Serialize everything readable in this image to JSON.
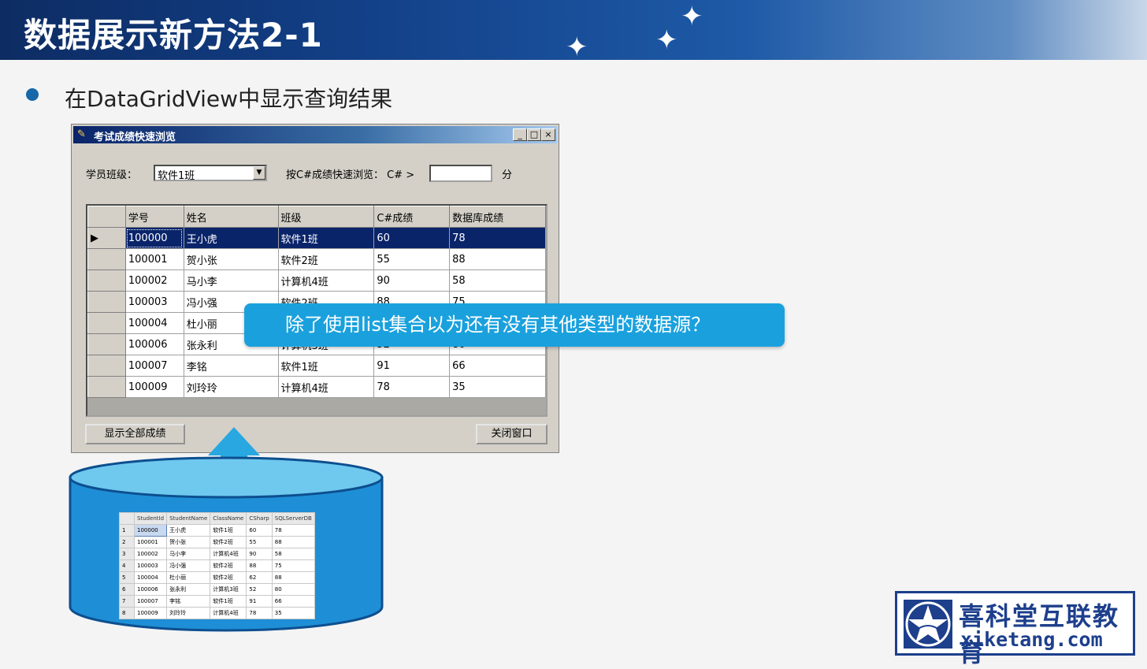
{
  "slide": {
    "title": "数据展示新方法2-1",
    "bullet": "在DataGridView中显示查询结果"
  },
  "form": {
    "title": "考试成绩快速浏览",
    "title_buttons": [
      "_",
      "□",
      "×"
    ],
    "class_label": "学员班级：",
    "class_value": "软件1班",
    "csharp_label": "按C#成绩快速浏览： C# >",
    "textbox_value": "",
    "unit_label": "分",
    "grid_columns": [
      "学号",
      "姓名",
      "班级",
      "C#成绩",
      "数据库成绩"
    ],
    "grid_rows": [
      [
        "100000",
        "王小虎",
        "软件1班",
        "60",
        "78"
      ],
      [
        "100001",
        "贺小张",
        "软件2班",
        "55",
        "88"
      ],
      [
        "100002",
        "马小李",
        "计算机4班",
        "90",
        "58"
      ],
      [
        "100003",
        "冯小强",
        "软件2班",
        "88",
        "75"
      ],
      [
        "100004",
        "杜小丽",
        "",
        "",
        ""
      ],
      [
        "100006",
        "张永利",
        "计算机3班",
        "52",
        "80"
      ],
      [
        "100007",
        "李铭",
        "软件1班",
        "91",
        "66"
      ],
      [
        "100009",
        "刘玲玲",
        "计算机4班",
        "78",
        "35"
      ]
    ],
    "selected_row_marker": "▶",
    "show_all_button": "显示全部成绩",
    "close_button": "关闭窗口"
  },
  "callout": {
    "text": "除了使用list集合以为还有没有其他类型的数据源？"
  },
  "database_table": {
    "columns": [
      "",
      "StudentId",
      "StudentName",
      "ClassName",
      "CSharp",
      "SQLServerDB"
    ],
    "rows": [
      [
        "1",
        "100000",
        "王小虎",
        "软件1班",
        "60",
        "78"
      ],
      [
        "2",
        "100001",
        "贺小张",
        "软件2班",
        "55",
        "88"
      ],
      [
        "3",
        "100002",
        "马小李",
        "计算机4班",
        "90",
        "58"
      ],
      [
        "4",
        "100003",
        "冯小强",
        "软件2班",
        "88",
        "75"
      ],
      [
        "5",
        "100004",
        "杜小丽",
        "软件2班",
        "62",
        "88"
      ],
      [
        "6",
        "100006",
        "张永利",
        "计算机3班",
        "52",
        "80"
      ],
      [
        "7",
        "100007",
        "李铭",
        "软件1班",
        "91",
        "66"
      ],
      [
        "8",
        "100009",
        "刘玲玲",
        "计算机4班",
        "78",
        "35"
      ]
    ]
  },
  "logo": {
    "cn": "喜科堂互联教育",
    "en": "xiketang.com"
  },
  "colors": {
    "banner": "#123f86",
    "callout": "#1aa1dd",
    "database": "#1e8fd6",
    "logo": "#1d3f8c"
  }
}
